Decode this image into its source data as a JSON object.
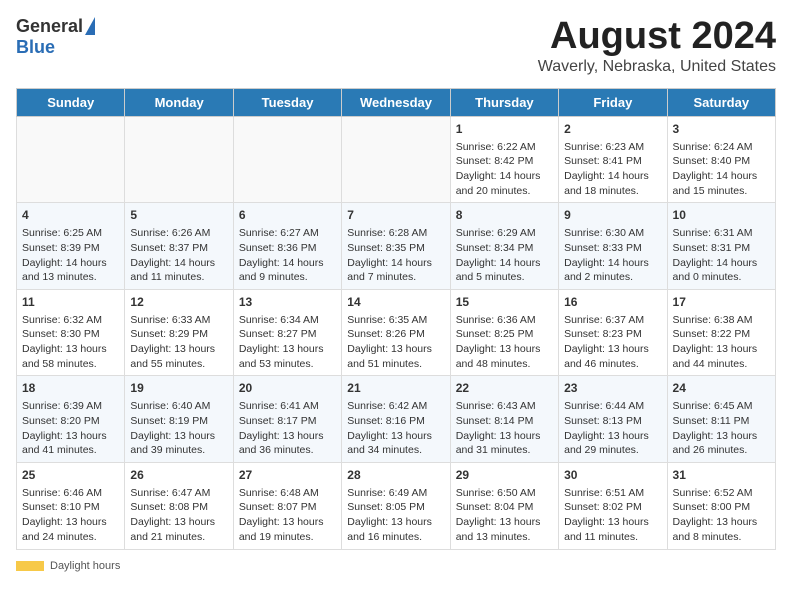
{
  "header": {
    "logo_general": "General",
    "logo_blue": "Blue",
    "title": "August 2024",
    "subtitle": "Waverly, Nebraska, United States"
  },
  "days_of_week": [
    "Sunday",
    "Monday",
    "Tuesday",
    "Wednesday",
    "Thursday",
    "Friday",
    "Saturday"
  ],
  "footer": {
    "daylight_label": "Daylight hours"
  },
  "weeks": [
    [
      {
        "day": "",
        "info": ""
      },
      {
        "day": "",
        "info": ""
      },
      {
        "day": "",
        "info": ""
      },
      {
        "day": "",
        "info": ""
      },
      {
        "day": "1",
        "info": "Sunrise: 6:22 AM\nSunset: 8:42 PM\nDaylight: 14 hours and 20 minutes."
      },
      {
        "day": "2",
        "info": "Sunrise: 6:23 AM\nSunset: 8:41 PM\nDaylight: 14 hours and 18 minutes."
      },
      {
        "day": "3",
        "info": "Sunrise: 6:24 AM\nSunset: 8:40 PM\nDaylight: 14 hours and 15 minutes."
      }
    ],
    [
      {
        "day": "4",
        "info": "Sunrise: 6:25 AM\nSunset: 8:39 PM\nDaylight: 14 hours and 13 minutes."
      },
      {
        "day": "5",
        "info": "Sunrise: 6:26 AM\nSunset: 8:37 PM\nDaylight: 14 hours and 11 minutes."
      },
      {
        "day": "6",
        "info": "Sunrise: 6:27 AM\nSunset: 8:36 PM\nDaylight: 14 hours and 9 minutes."
      },
      {
        "day": "7",
        "info": "Sunrise: 6:28 AM\nSunset: 8:35 PM\nDaylight: 14 hours and 7 minutes."
      },
      {
        "day": "8",
        "info": "Sunrise: 6:29 AM\nSunset: 8:34 PM\nDaylight: 14 hours and 5 minutes."
      },
      {
        "day": "9",
        "info": "Sunrise: 6:30 AM\nSunset: 8:33 PM\nDaylight: 14 hours and 2 minutes."
      },
      {
        "day": "10",
        "info": "Sunrise: 6:31 AM\nSunset: 8:31 PM\nDaylight: 14 hours and 0 minutes."
      }
    ],
    [
      {
        "day": "11",
        "info": "Sunrise: 6:32 AM\nSunset: 8:30 PM\nDaylight: 13 hours and 58 minutes."
      },
      {
        "day": "12",
        "info": "Sunrise: 6:33 AM\nSunset: 8:29 PM\nDaylight: 13 hours and 55 minutes."
      },
      {
        "day": "13",
        "info": "Sunrise: 6:34 AM\nSunset: 8:27 PM\nDaylight: 13 hours and 53 minutes."
      },
      {
        "day": "14",
        "info": "Sunrise: 6:35 AM\nSunset: 8:26 PM\nDaylight: 13 hours and 51 minutes."
      },
      {
        "day": "15",
        "info": "Sunrise: 6:36 AM\nSunset: 8:25 PM\nDaylight: 13 hours and 48 minutes."
      },
      {
        "day": "16",
        "info": "Sunrise: 6:37 AM\nSunset: 8:23 PM\nDaylight: 13 hours and 46 minutes."
      },
      {
        "day": "17",
        "info": "Sunrise: 6:38 AM\nSunset: 8:22 PM\nDaylight: 13 hours and 44 minutes."
      }
    ],
    [
      {
        "day": "18",
        "info": "Sunrise: 6:39 AM\nSunset: 8:20 PM\nDaylight: 13 hours and 41 minutes."
      },
      {
        "day": "19",
        "info": "Sunrise: 6:40 AM\nSunset: 8:19 PM\nDaylight: 13 hours and 39 minutes."
      },
      {
        "day": "20",
        "info": "Sunrise: 6:41 AM\nSunset: 8:17 PM\nDaylight: 13 hours and 36 minutes."
      },
      {
        "day": "21",
        "info": "Sunrise: 6:42 AM\nSunset: 8:16 PM\nDaylight: 13 hours and 34 minutes."
      },
      {
        "day": "22",
        "info": "Sunrise: 6:43 AM\nSunset: 8:14 PM\nDaylight: 13 hours and 31 minutes."
      },
      {
        "day": "23",
        "info": "Sunrise: 6:44 AM\nSunset: 8:13 PM\nDaylight: 13 hours and 29 minutes."
      },
      {
        "day": "24",
        "info": "Sunrise: 6:45 AM\nSunset: 8:11 PM\nDaylight: 13 hours and 26 minutes."
      }
    ],
    [
      {
        "day": "25",
        "info": "Sunrise: 6:46 AM\nSunset: 8:10 PM\nDaylight: 13 hours and 24 minutes."
      },
      {
        "day": "26",
        "info": "Sunrise: 6:47 AM\nSunset: 8:08 PM\nDaylight: 13 hours and 21 minutes."
      },
      {
        "day": "27",
        "info": "Sunrise: 6:48 AM\nSunset: 8:07 PM\nDaylight: 13 hours and 19 minutes."
      },
      {
        "day": "28",
        "info": "Sunrise: 6:49 AM\nSunset: 8:05 PM\nDaylight: 13 hours and 16 minutes."
      },
      {
        "day": "29",
        "info": "Sunrise: 6:50 AM\nSunset: 8:04 PM\nDaylight: 13 hours and 13 minutes."
      },
      {
        "day": "30",
        "info": "Sunrise: 6:51 AM\nSunset: 8:02 PM\nDaylight: 13 hours and 11 minutes."
      },
      {
        "day": "31",
        "info": "Sunrise: 6:52 AM\nSunset: 8:00 PM\nDaylight: 13 hours and 8 minutes."
      }
    ]
  ]
}
